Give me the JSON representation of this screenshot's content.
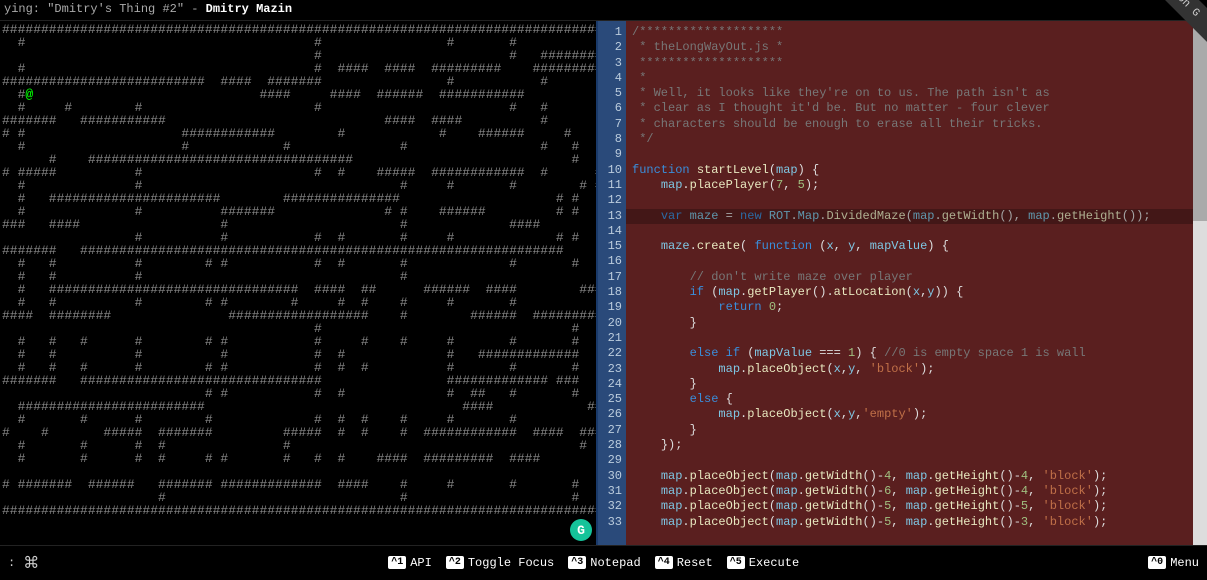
{
  "topbar": {
    "prefix": "ying: ",
    "track": "\"Dmitry's Thing #2\"",
    "sep": " - ",
    "artist": "Dmitry Mazin"
  },
  "fork_label": "rk me on G",
  "maze_rows": [
    "###################################################################################",
    "  #                                     #                #       #                 ",
    "                                        #                        #   #############",
    "  #                                     #  ####  ####  #########    ##############",
    "##########################  ####  #######                #           #             ",
    "  #@                             ####     ####  ######  ###########                ",
    "  #     #        #                      #                        #   #             ",
    "#######   ###########                            ####  ####          #           ##",
    "# #                    ############        #            #    ######     #          ",
    "  #                    #            #              #                 #   #      #  ",
    "      #    ##################################                            #         ",
    "# #####          #                      #  #    #####  ############  #      ###   #",
    "  #              #                                 #     #       #        # #      ",
    "  #   ######################        ###############                    # #         ",
    "  #              #          #######              # #    ######         # #         ",
    "###   ####                  #                      #             ####               ",
    "                 #          #           #  #       #     #             # #    ####",
    "#######   ##############################################################           ",
    "  #   #          #        # #           #  #       #             #       #         ",
    "  #   #          #                                 #                               ",
    "  #   ################################  ####  ##      ######  ####        #########",
    "  #   #          #        # #        #     #  #    #     #       #                 ",
    "####  ########               ##################    #        ######  ##########  ###",
    "                                        #                                #         ",
    "  #   #   #      #        # #           #     #    #     #       #       #      #  ",
    "  #   #          #          #           #  #             #   #############      #  ",
    "  #   #   #      #        # #           #  #  #          #       #       #      #  ",
    "#######   ###############################                ############# ###         ",
    "                          # #           #  #             #  ##   #       #      #  ",
    "  ########################                                 ####            ##      ",
    "  #       #      #        #             #  #  #    #     #       #             #   ",
    "#    #       #####  #######         #####  #  #    #  ############  ####  ####  ###",
    "  #       #      #  #               #                                     #    [#  ",
    "  #       #      #  #     # #       #   #  #    ####  #########  ####               ",
    "                                                                                   ",
    "# #######  ######   ####### #############  ####    #     #       #       #      #  ",
    "                    #                              #                     #      # #",
    "###################################################################################"
  ],
  "player": {
    "row": 5,
    "col": 3
  },
  "cursor_box": {
    "row": 32,
    "col": 79
  },
  "code": {
    "highlighted_line": 13,
    "lines": [
      {
        "n": 1,
        "t": [
          [
            "c-comment",
            "/********************"
          ]
        ]
      },
      {
        "n": 2,
        "t": [
          [
            "c-comment",
            " * theLongWayOut.js *"
          ]
        ]
      },
      {
        "n": 3,
        "t": [
          [
            "c-comment",
            " ********************"
          ]
        ]
      },
      {
        "n": 4,
        "t": [
          [
            "c-comment",
            " *"
          ]
        ]
      },
      {
        "n": 5,
        "t": [
          [
            "c-comment",
            " * Well, it looks like they're on to us. The path isn't as"
          ]
        ]
      },
      {
        "n": 6,
        "t": [
          [
            "c-comment",
            " * clear as I thought it'd be. But no matter - four clever"
          ]
        ]
      },
      {
        "n": 7,
        "t": [
          [
            "c-comment",
            " * characters should be enough to erase all their tricks."
          ]
        ]
      },
      {
        "n": 8,
        "t": [
          [
            "c-comment",
            " */"
          ]
        ]
      },
      {
        "n": 9,
        "t": [
          [
            "",
            ""
          ]
        ]
      },
      {
        "n": 10,
        "t": [
          [
            "c-kw",
            "function "
          ],
          [
            "c-fn",
            "startLevel"
          ],
          [
            "c-punc",
            "("
          ],
          [
            "c-var",
            "map"
          ],
          [
            "c-punc",
            ") {"
          ]
        ]
      },
      {
        "n": 11,
        "t": [
          [
            "",
            "    "
          ],
          [
            "c-var",
            "map"
          ],
          [
            "c-punc",
            "."
          ],
          [
            "c-fn",
            "placePlayer"
          ],
          [
            "c-punc",
            "("
          ],
          [
            "c-num",
            "7"
          ],
          [
            "c-punc",
            ", "
          ],
          [
            "c-num",
            "5"
          ],
          [
            "c-punc",
            ");"
          ]
        ]
      },
      {
        "n": 12,
        "t": [
          [
            "",
            ""
          ]
        ]
      },
      {
        "n": 13,
        "t": [
          [
            "",
            "    "
          ],
          [
            "c-kw",
            "var "
          ],
          [
            "c-var",
            "maze"
          ],
          [
            "c-punc",
            " = "
          ],
          [
            "c-kw",
            "new "
          ],
          [
            "c-var",
            "ROT"
          ],
          [
            "c-punc",
            "."
          ],
          [
            "c-var",
            "Map"
          ],
          [
            "c-punc",
            "."
          ],
          [
            "c-fn",
            "DividedMaze"
          ],
          [
            "c-punc",
            "("
          ],
          [
            "c-var",
            "map"
          ],
          [
            "c-punc",
            "."
          ],
          [
            "c-fn",
            "getWidth"
          ],
          [
            "c-punc",
            "(), "
          ],
          [
            "c-var",
            "map"
          ],
          [
            "c-punc",
            "."
          ],
          [
            "c-fn",
            "getHeight"
          ],
          [
            "c-punc",
            "());"
          ]
        ]
      },
      {
        "n": 14,
        "t": [
          [
            "",
            ""
          ]
        ]
      },
      {
        "n": 15,
        "t": [
          [
            "",
            "    "
          ],
          [
            "c-var",
            "maze"
          ],
          [
            "c-punc",
            "."
          ],
          [
            "c-fn",
            "create"
          ],
          [
            "c-punc",
            "( "
          ],
          [
            "c-kw",
            "function "
          ],
          [
            "c-punc",
            "("
          ],
          [
            "c-var",
            "x"
          ],
          [
            "c-punc",
            ", "
          ],
          [
            "c-var",
            "y"
          ],
          [
            "c-punc",
            ", "
          ],
          [
            "c-var",
            "mapValue"
          ],
          [
            "c-punc",
            ") {"
          ]
        ]
      },
      {
        "n": 16,
        "t": [
          [
            "",
            ""
          ]
        ]
      },
      {
        "n": 17,
        "t": [
          [
            "",
            "        "
          ],
          [
            "c-comment",
            "// don't write maze over player"
          ]
        ]
      },
      {
        "n": 18,
        "t": [
          [
            "",
            "        "
          ],
          [
            "c-kw",
            "if "
          ],
          [
            "c-punc",
            "("
          ],
          [
            "c-var",
            "map"
          ],
          [
            "c-punc",
            "."
          ],
          [
            "c-fn",
            "getPlayer"
          ],
          [
            "c-punc",
            "()."
          ],
          [
            "c-fn",
            "atLocation"
          ],
          [
            "c-punc",
            "("
          ],
          [
            "c-var",
            "x"
          ],
          [
            "c-punc",
            ","
          ],
          [
            "c-var",
            "y"
          ],
          [
            "c-punc",
            ")) {"
          ]
        ]
      },
      {
        "n": 19,
        "t": [
          [
            "",
            "            "
          ],
          [
            "c-kw",
            "return "
          ],
          [
            "c-num",
            "0"
          ],
          [
            "c-punc",
            ";"
          ]
        ]
      },
      {
        "n": 20,
        "t": [
          [
            "",
            "        "
          ],
          [
            "c-punc",
            "}"
          ]
        ]
      },
      {
        "n": 21,
        "t": [
          [
            "",
            ""
          ]
        ]
      },
      {
        "n": 22,
        "t": [
          [
            "",
            "        "
          ],
          [
            "c-kw",
            "else if "
          ],
          [
            "c-punc",
            "("
          ],
          [
            "c-var",
            "mapValue"
          ],
          [
            "c-punc",
            " === "
          ],
          [
            "c-num",
            "1"
          ],
          [
            "c-punc",
            ") { "
          ],
          [
            "c-comment",
            "//0 is empty space 1 is wall"
          ]
        ]
      },
      {
        "n": 23,
        "t": [
          [
            "",
            "            "
          ],
          [
            "c-var",
            "map"
          ],
          [
            "c-punc",
            "."
          ],
          [
            "c-fn",
            "placeObject"
          ],
          [
            "c-punc",
            "("
          ],
          [
            "c-var",
            "x"
          ],
          [
            "c-punc",
            ","
          ],
          [
            "c-var",
            "y"
          ],
          [
            "c-punc",
            ", "
          ],
          [
            "c-str",
            "'block'"
          ],
          [
            "c-punc",
            ");"
          ]
        ]
      },
      {
        "n": 24,
        "t": [
          [
            "",
            "        "
          ],
          [
            "c-punc",
            "}"
          ]
        ]
      },
      {
        "n": 25,
        "t": [
          [
            "",
            "        "
          ],
          [
            "c-kw",
            "else "
          ],
          [
            "c-punc",
            "{"
          ]
        ]
      },
      {
        "n": 26,
        "t": [
          [
            "",
            "            "
          ],
          [
            "c-var",
            "map"
          ],
          [
            "c-punc",
            "."
          ],
          [
            "c-fn",
            "placeObject"
          ],
          [
            "c-punc",
            "("
          ],
          [
            "c-var",
            "x"
          ],
          [
            "c-punc",
            ","
          ],
          [
            "c-var",
            "y"
          ],
          [
            "c-punc",
            ","
          ],
          [
            "c-str",
            "'empty'"
          ],
          [
            "c-punc",
            ");"
          ]
        ]
      },
      {
        "n": 27,
        "t": [
          [
            "",
            "        "
          ],
          [
            "c-punc",
            "}"
          ]
        ]
      },
      {
        "n": 28,
        "t": [
          [
            "",
            "    "
          ],
          [
            "c-punc",
            "});"
          ]
        ]
      },
      {
        "n": 29,
        "t": [
          [
            "",
            ""
          ]
        ]
      },
      {
        "n": 30,
        "t": [
          [
            "",
            "    "
          ],
          [
            "c-var",
            "map"
          ],
          [
            "c-punc",
            "."
          ],
          [
            "c-fn",
            "placeObject"
          ],
          [
            "c-punc",
            "("
          ],
          [
            "c-var",
            "map"
          ],
          [
            "c-punc",
            "."
          ],
          [
            "c-fn",
            "getWidth"
          ],
          [
            "c-punc",
            "()-"
          ],
          [
            "c-num",
            "4"
          ],
          [
            "c-punc",
            ", "
          ],
          [
            "c-var",
            "map"
          ],
          [
            "c-punc",
            "."
          ],
          [
            "c-fn",
            "getHeight"
          ],
          [
            "c-punc",
            "()-"
          ],
          [
            "c-num",
            "4"
          ],
          [
            "c-punc",
            ", "
          ],
          [
            "c-str",
            "'block'"
          ],
          [
            "c-punc",
            ");"
          ]
        ]
      },
      {
        "n": 31,
        "t": [
          [
            "",
            "    "
          ],
          [
            "c-var",
            "map"
          ],
          [
            "c-punc",
            "."
          ],
          [
            "c-fn",
            "placeObject"
          ],
          [
            "c-punc",
            "("
          ],
          [
            "c-var",
            "map"
          ],
          [
            "c-punc",
            "."
          ],
          [
            "c-fn",
            "getWidth"
          ],
          [
            "c-punc",
            "()-"
          ],
          [
            "c-num",
            "6"
          ],
          [
            "c-punc",
            ", "
          ],
          [
            "c-var",
            "map"
          ],
          [
            "c-punc",
            "."
          ],
          [
            "c-fn",
            "getHeight"
          ],
          [
            "c-punc",
            "()-"
          ],
          [
            "c-num",
            "4"
          ],
          [
            "c-punc",
            ", "
          ],
          [
            "c-str",
            "'block'"
          ],
          [
            "c-punc",
            ");"
          ]
        ]
      },
      {
        "n": 32,
        "t": [
          [
            "",
            "    "
          ],
          [
            "c-var",
            "map"
          ],
          [
            "c-punc",
            "."
          ],
          [
            "c-fn",
            "placeObject"
          ],
          [
            "c-punc",
            "("
          ],
          [
            "c-var",
            "map"
          ],
          [
            "c-punc",
            "."
          ],
          [
            "c-fn",
            "getWidth"
          ],
          [
            "c-punc",
            "()-"
          ],
          [
            "c-num",
            "5"
          ],
          [
            "c-punc",
            ", "
          ],
          [
            "c-var",
            "map"
          ],
          [
            "c-punc",
            "."
          ],
          [
            "c-fn",
            "getHeight"
          ],
          [
            "c-punc",
            "()-"
          ],
          [
            "c-num",
            "5"
          ],
          [
            "c-punc",
            ", "
          ],
          [
            "c-str",
            "'block'"
          ],
          [
            "c-punc",
            ");"
          ]
        ]
      },
      {
        "n": 33,
        "t": [
          [
            "",
            "    "
          ],
          [
            "c-var",
            "map"
          ],
          [
            "c-punc",
            "."
          ],
          [
            "c-fn",
            "placeObject"
          ],
          [
            "c-punc",
            "("
          ],
          [
            "c-var",
            "map"
          ],
          [
            "c-punc",
            "."
          ],
          [
            "c-fn",
            "getWidth"
          ],
          [
            "c-punc",
            "()-"
          ],
          [
            "c-num",
            "5"
          ],
          [
            "c-punc",
            ", "
          ],
          [
            "c-var",
            "map"
          ],
          [
            "c-punc",
            "."
          ],
          [
            "c-fn",
            "getHeight"
          ],
          [
            "c-punc",
            "()-"
          ],
          [
            "c-num",
            "3"
          ],
          [
            "c-punc",
            ", "
          ],
          [
            "c-str",
            "'block'"
          ],
          [
            "c-punc",
            ");"
          ]
        ]
      }
    ]
  },
  "bottombar": {
    "prompt": ":",
    "cmd_symbol": "⌘",
    "shortcuts": [
      {
        "key": "^1",
        "label": "API"
      },
      {
        "key": "^2",
        "label": "Toggle Focus"
      },
      {
        "key": "^3",
        "label": "Notepad"
      },
      {
        "key": "^4",
        "label": "Reset"
      },
      {
        "key": "^5",
        "label": "Execute"
      }
    ],
    "menu": {
      "key": "^0",
      "label": "Menu"
    }
  }
}
